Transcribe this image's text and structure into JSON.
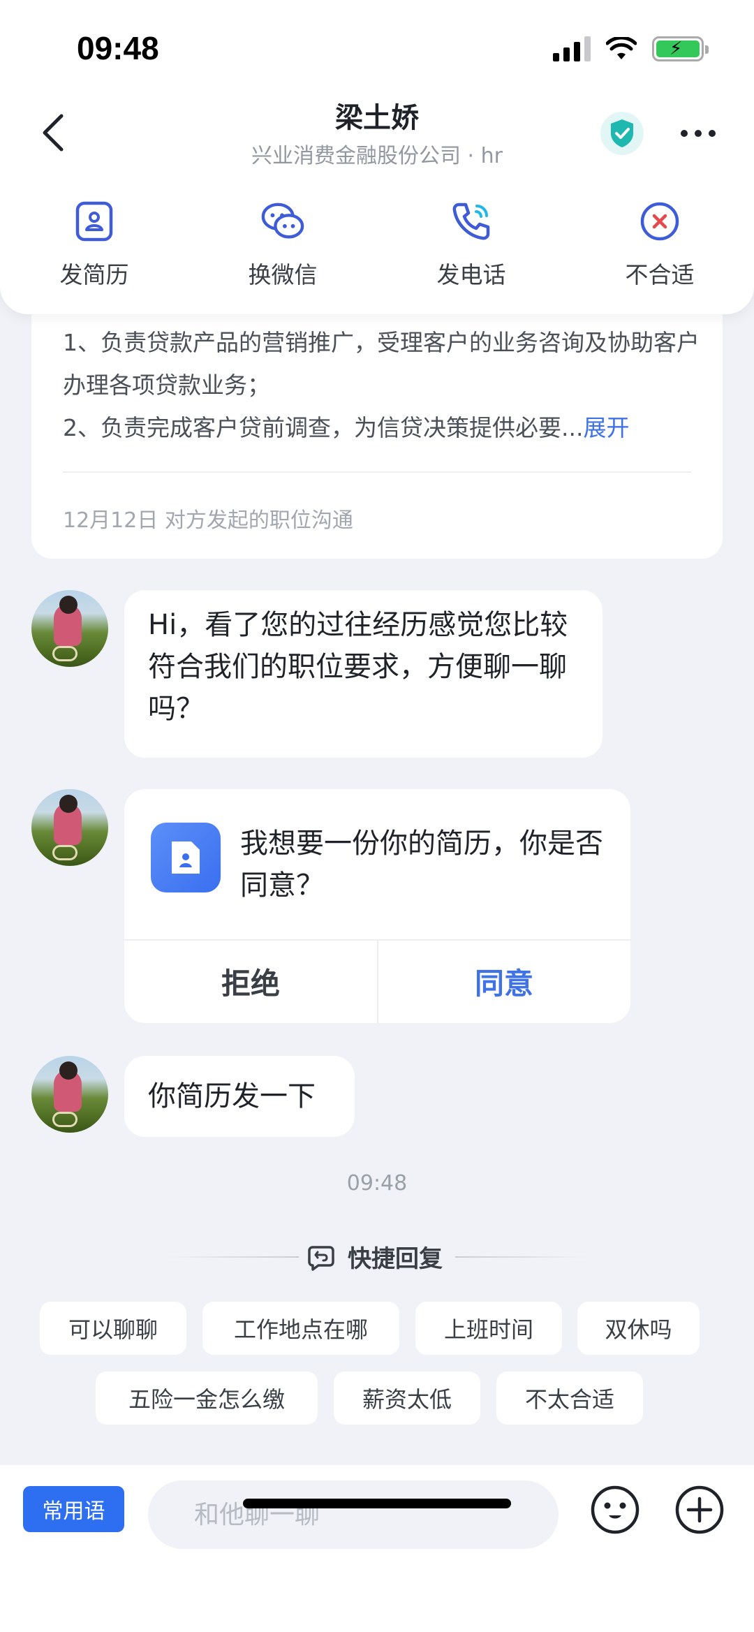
{
  "status_bar": {
    "time": "09:48"
  },
  "header": {
    "title": "梁土娇",
    "subtitle": "兴业消费金融股份公司 · hr"
  },
  "actions": [
    {
      "label": "发简历",
      "icon": "resume-icon"
    },
    {
      "label": "换微信",
      "icon": "wechat-icon"
    },
    {
      "label": "发电话",
      "icon": "phone-icon"
    },
    {
      "label": "不合适",
      "icon": "close-circle-icon"
    }
  ],
  "job_card": {
    "line1": "1、负责贷款产品的营销推广，受理客户的业务咨询及协助客户办理各项贷款业务；",
    "line2": "2、负责完成客户贷前调查，为信贷决策提供必要...",
    "expand": "展开",
    "note": "12月12日 对方发起的职位沟通"
  },
  "messages": {
    "m1": "Hi，看了您的过往经历感觉您比较符合我们的职位要求，方便聊一聊吗？",
    "resume_request": {
      "question": "我想要一份你的简历，你是否同意？",
      "reject": "拒绝",
      "accept": "同意"
    },
    "m3": "你简历发一下",
    "timestamp": "09:48"
  },
  "quick_reply": {
    "title": "快捷回复",
    "chips": [
      "可以聊聊",
      "工作地点在哪",
      "上班时间",
      "双休吗",
      "五险一金怎么缴",
      "薪资太低",
      "不太合适"
    ]
  },
  "input_bar": {
    "common_phrases": "常用语",
    "placeholder": "和他聊一聊"
  },
  "colors": {
    "accent": "#2e6ff2",
    "link": "#3e72e6",
    "background": "#f0f2f7",
    "verified": "#1fb8b0"
  }
}
